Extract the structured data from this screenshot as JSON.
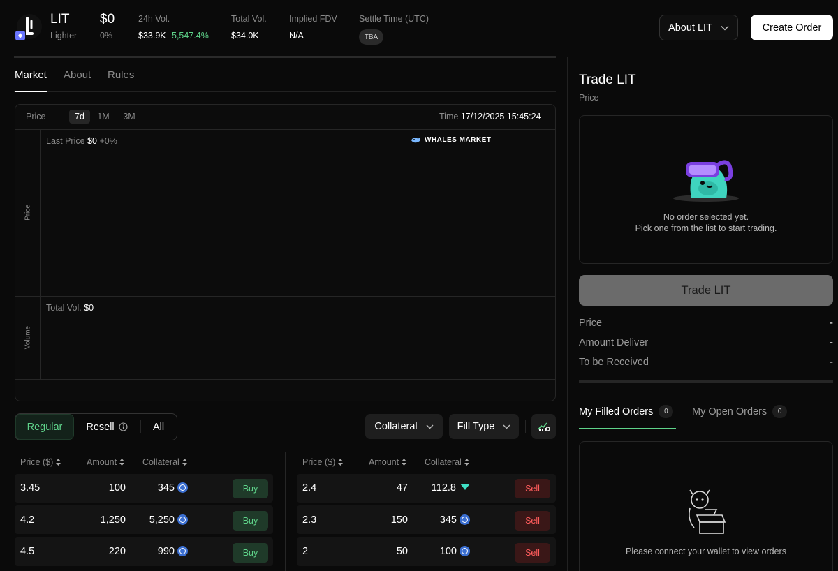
{
  "token": {
    "symbol": "LIT",
    "project": "Lighter",
    "price": "$0",
    "change": "0%"
  },
  "stats": {
    "vol24_label": "24h Vol.",
    "vol24_value": "$33.9K",
    "vol24_change": "5,547.4%",
    "total_vol_label": "Total Vol.",
    "total_vol_value": "$34.0K",
    "fdv_label": "Implied FDV",
    "fdv_value": "N/A",
    "settle_label": "Settle Time (UTC)",
    "settle_value": "TBA"
  },
  "header_buttons": {
    "about": "About LIT",
    "create": "Create Order"
  },
  "tabs": [
    "Market",
    "About",
    "Rules"
  ],
  "chart": {
    "price_label": "Price",
    "ranges": [
      "7d",
      "1M",
      "3M"
    ],
    "time_label": "Time",
    "time_value": "17/12/2025 15:45:24",
    "last_price_label": "Last Price",
    "last_price_value": "$0",
    "last_price_change": "+0%",
    "watermark": "WHALES MARKET",
    "y_price_axis": "Price",
    "y_volume_axis": "Volume",
    "total_vol_label": "Total Vol.",
    "total_vol_value": "$0"
  },
  "filters": {
    "regular": "Regular",
    "resell": "Resell",
    "all": "All",
    "collateral": "Collateral",
    "fill_type": "Fill Type"
  },
  "buy_table": {
    "headers": [
      "Price ($)",
      "Amount",
      "Collateral"
    ],
    "rows": [
      {
        "price": "3.45",
        "amount": "100",
        "collateral": "345",
        "action": "Buy"
      },
      {
        "price": "4.2",
        "amount": "1,250",
        "collateral": "5,250",
        "action": "Buy"
      },
      {
        "price": "4.5",
        "amount": "220",
        "collateral": "990",
        "action": "Buy"
      }
    ]
  },
  "sell_table": {
    "headers": [
      "Price ($)",
      "Amount",
      "Collateral"
    ],
    "rows": [
      {
        "price": "2.4",
        "amount": "47",
        "collateral": "112.8",
        "action": "Sell"
      },
      {
        "price": "2.3",
        "amount": "150",
        "collateral": "345",
        "action": "Sell"
      },
      {
        "price": "2",
        "amount": "50",
        "collateral": "100",
        "action": "Sell"
      }
    ]
  },
  "trade_panel": {
    "title": "Trade LIT",
    "price_line": "Price -",
    "empty_line1": "No order selected yet.",
    "empty_line2": "Pick one from the list to start trading.",
    "trade_button": "Trade LIT",
    "price_label": "Price",
    "price_value": "-",
    "deliver_label": "Amount Deliver",
    "deliver_value": "-",
    "receive_label": "To be Received",
    "receive_value": "-"
  },
  "orders_panel": {
    "filled_label": "My Filled Orders",
    "filled_count": "0",
    "open_label": "My Open Orders",
    "open_count": "0",
    "empty_text": "Please connect your wallet to view orders"
  },
  "colors": {
    "accent_green": "#5fd38a",
    "sell_red": "#ff5c5c",
    "background": "#0a0a0a"
  }
}
